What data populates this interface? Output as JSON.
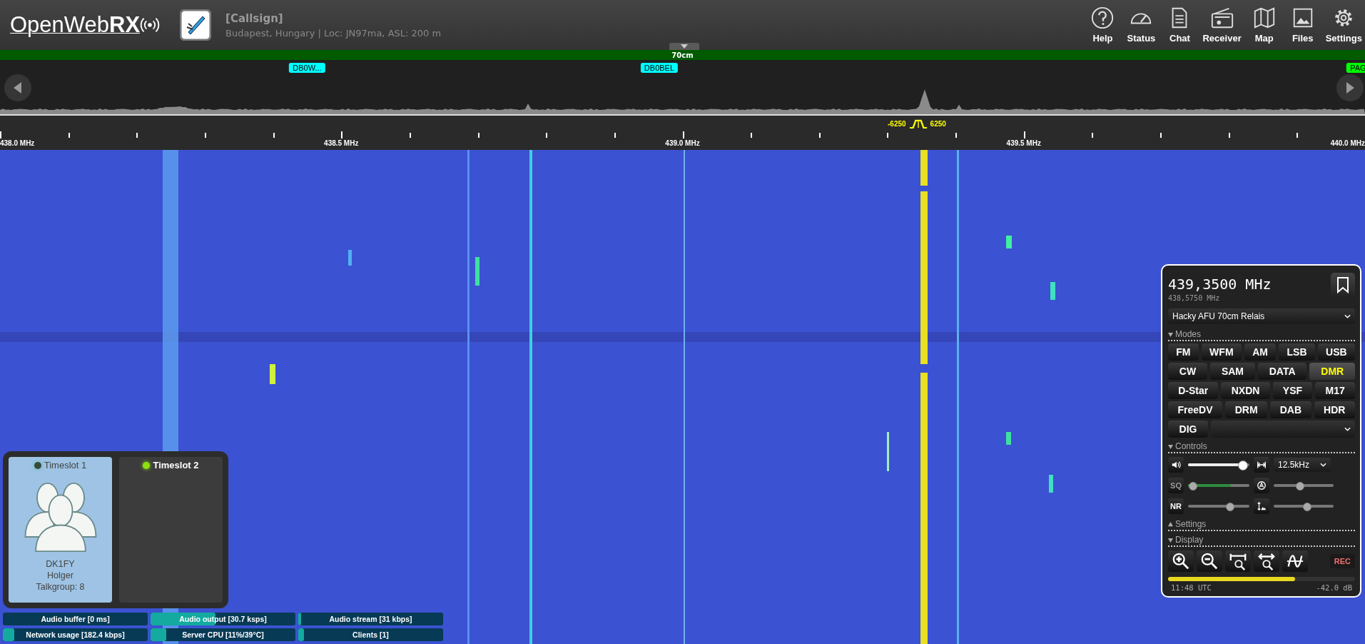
{
  "header": {
    "logo": "OpenWeb**RX**",
    "callsign": "[Callsign]",
    "location": "Budapest, Hungary | Loc: JN97ma, ASL: 200 m",
    "nav_buttons": [
      {
        "label": "Help",
        "kind": "help"
      },
      {
        "label": "Status",
        "kind": "status"
      },
      {
        "label": "Chat",
        "kind": "chat"
      },
      {
        "label": "Receiver",
        "kind": "receiver"
      },
      {
        "label": "Map",
        "kind": "map"
      },
      {
        "label": "Files",
        "kind": "files"
      },
      {
        "label": "Settings",
        "kind": "settings"
      }
    ]
  },
  "band": "70cm",
  "bookmarks": [
    {
      "label": "DB0W...",
      "color": "#00ffff"
    },
    {
      "label": "DB0BEL",
      "color": "#00ffff"
    },
    {
      "label": "PAG",
      "color": "#00ff00"
    }
  ],
  "scale": {
    "labels": [
      "438.0 MHz",
      "438.5 MHz",
      "439.0 MHz",
      "439.5 MHz",
      "440.0 MHz"
    ],
    "passband": {
      "low": "-6250",
      "high": "6250"
    }
  },
  "dmr": {
    "slots": [
      {
        "label": "Timeslot 1",
        "active": true,
        "callsign": "DK1FY",
        "name": "Holger",
        "talkgroup": "Talkgroup: 8"
      },
      {
        "label": "Timeslot 2",
        "active": false
      }
    ]
  },
  "status_bars": [
    {
      "label": "Audio buffer [0 ms]"
    },
    {
      "label": "Audio output [30.7 ksps]",
      "level": 0.45
    },
    {
      "label": "Audio stream [31 kbps]",
      "level": 0.02
    },
    {
      "label": "Network usage [182.4 kbps]",
      "level": 0.08
    },
    {
      "label": "Server CPU [11%/39°C]",
      "level": 0.11
    },
    {
      "label": "Clients [1]",
      "level": 0.04
    }
  ],
  "panel": {
    "frequency": "439,3500 MHz",
    "offset_frequency": "438,5750 MHz",
    "bookmark": "Hacky AFU 70cm Relais",
    "sections": [
      {
        "title": "Modes",
        "expanded": true
      },
      {
        "title": "Controls",
        "expanded": true
      },
      {
        "title": "Settings",
        "expanded": false
      },
      {
        "title": "Display",
        "expanded": true
      }
    ],
    "modes": [
      [
        {
          "label": "FM",
          "selected": false
        },
        {
          "label": "WFM",
          "selected": false
        },
        {
          "label": "AM",
          "selected": false
        },
        {
          "label": "LSB",
          "selected": false
        },
        {
          "label": "USB",
          "selected": false
        }
      ],
      [
        {
          "label": "CW",
          "selected": false
        },
        {
          "label": "SAM",
          "selected": false
        },
        {
          "label": "DATA",
          "selected": false
        },
        {
          "label": "DMR",
          "selected": true
        }
      ],
      [
        {
          "label": "D-Star",
          "selected": false
        },
        {
          "label": "NXDN",
          "selected": false
        },
        {
          "label": "YSF",
          "selected": false
        },
        {
          "label": "M17",
          "selected": false
        }
      ],
      [
        {
          "label": "FreeDV",
          "selected": false
        },
        {
          "label": "DRM",
          "selected": false
        },
        {
          "label": "DAB",
          "selected": false
        },
        {
          "label": "HDR",
          "selected": false
        }
      ]
    ],
    "digital_mode": {
      "label": "DIG",
      "selected": false
    },
    "volume": {
      "level": 0.95
    },
    "bandwidth": "12.5kHz",
    "squelch": {
      "label": "SQ",
      "level": 0,
      "meter": {
        "level": 0.7
      }
    },
    "agc": {
      "level": 0.42
    },
    "noise_reduction": {
      "label": "NR",
      "level": 0.7
    },
    "gain": {
      "level": 0.55
    },
    "rec": "REC",
    "smeter": {
      "level": 0.68
    },
    "time": "11:48 UTC",
    "db": "-42.0 dB"
  }
}
